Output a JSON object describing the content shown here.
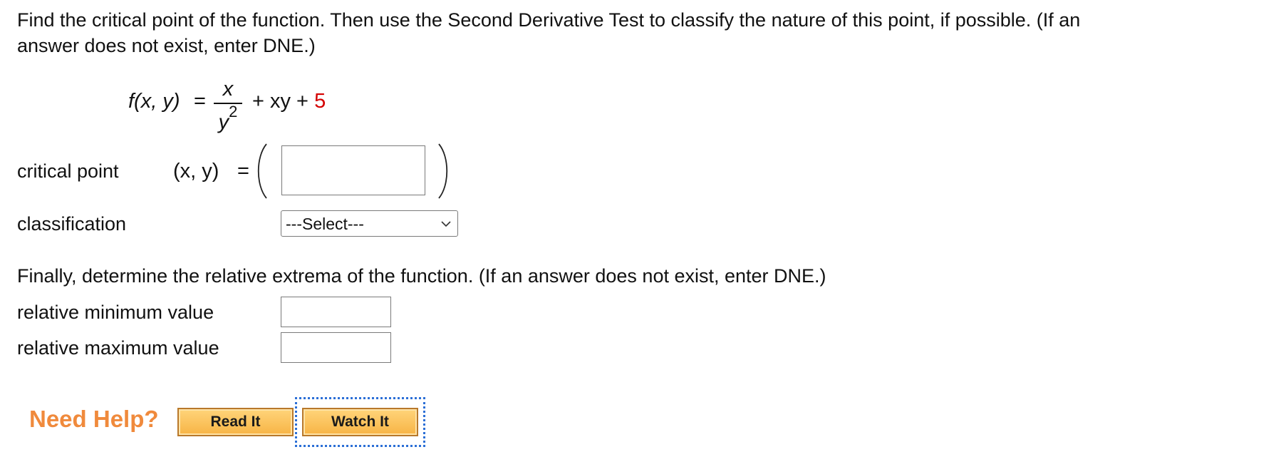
{
  "question": {
    "line1": "Find the critical point of the function. Then use the Second Derivative Test to classify the nature of this point, if possible. (If an",
    "line2": "answer does not exist, enter DNE.)"
  },
  "formula": {
    "lhs": "f(x, y)",
    "equals": "=",
    "numerator": "x",
    "denominator_base": "y",
    "denominator_exp": "2",
    "middle": "+ xy +",
    "constant": "5",
    "constant_color": "#d40000"
  },
  "critical_point": {
    "label": "critical point",
    "xy": "(x, y)",
    "equals": "=",
    "value": ""
  },
  "classification": {
    "label": "classification",
    "selected": "---Select---"
  },
  "extrema": {
    "instruction": "Finally, determine the relative extrema of the function. (If an answer does not exist, enter DNE.)",
    "min_label": "relative minimum value",
    "min_value": "",
    "max_label": "relative maximum value",
    "max_value": ""
  },
  "help": {
    "title": "Need Help?",
    "read_label": "Read It",
    "watch_label": "Watch It",
    "accent_color": "#f08a3c",
    "focus_color": "#2c6fd6"
  }
}
